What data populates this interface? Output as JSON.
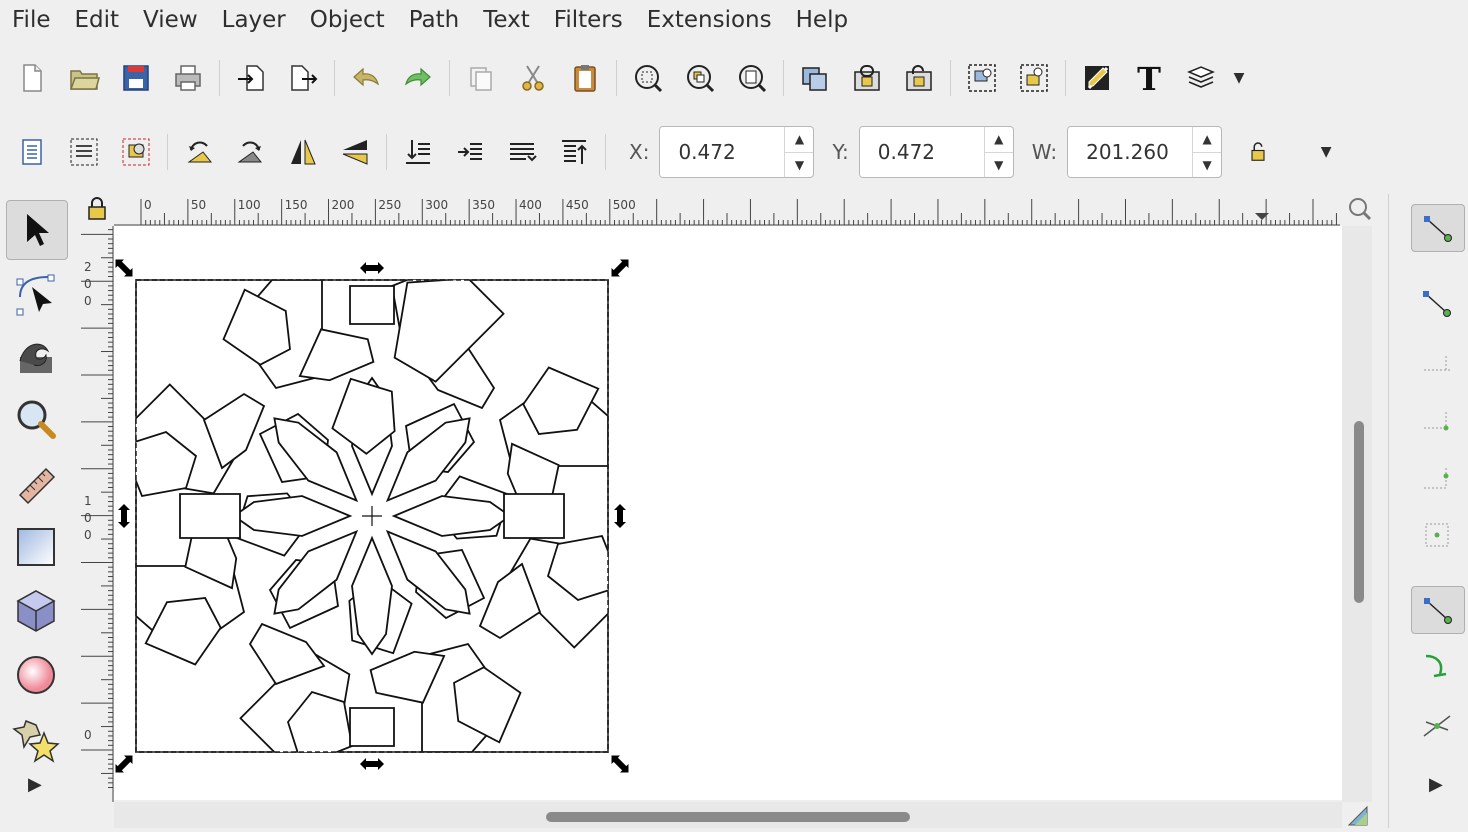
{
  "menu": [
    "File",
    "Edit",
    "View",
    "Layer",
    "Object",
    "Path",
    "Text",
    "Filters",
    "Extensions",
    "Help"
  ],
  "toolbar_main": [
    {
      "name": "new-document-icon"
    },
    {
      "name": "open-document-icon"
    },
    {
      "name": "save-document-icon"
    },
    {
      "name": "print-icon"
    },
    {
      "name": "import-icon"
    },
    {
      "name": "export-icon"
    },
    {
      "name": "undo-icon"
    },
    {
      "name": "redo-icon"
    },
    {
      "name": "copy-icon"
    },
    {
      "name": "cut-icon"
    },
    {
      "name": "paste-icon"
    },
    {
      "name": "zoom-selection-icon"
    },
    {
      "name": "zoom-drawing-icon"
    },
    {
      "name": "zoom-page-icon"
    },
    {
      "name": "duplicate-icon"
    },
    {
      "name": "clone-icon"
    },
    {
      "name": "unlink-clone-icon"
    },
    {
      "name": "group-icon"
    },
    {
      "name": "ungroup-icon"
    },
    {
      "name": "fill-stroke-icon"
    },
    {
      "name": "text-font-icon"
    },
    {
      "name": "layers-icon"
    }
  ],
  "transform": {
    "x_label": "X:",
    "x_value": "0.472",
    "y_label": "Y:",
    "y_value": "0.472",
    "w_label": "W:",
    "w_value": "201.260"
  },
  "ruler": {
    "h_labels": [
      "0",
      "50",
      "100",
      "150",
      "200",
      "250",
      "300",
      "350",
      "400",
      "450",
      "500"
    ],
    "v_labels": [
      "200",
      "100",
      "0"
    ]
  },
  "tools": [
    "selector-tool",
    "node-tool",
    "tweak-tool",
    "zoom-tool",
    "measure-tool",
    "rectangle-tool",
    "box3d-tool",
    "ellipse-tool",
    "star-tool"
  ],
  "snap_controls": [
    "snap-toggle",
    "snap-nodes",
    "snap-bbox-edges",
    "snap-bbox-corners",
    "snap-bbox-midpoints",
    "snap-bbox-center",
    "snap-others",
    "snap-path",
    "snap-intersection"
  ],
  "colors": {
    "accent": "#3b6fc7",
    "selection": "#000000"
  }
}
